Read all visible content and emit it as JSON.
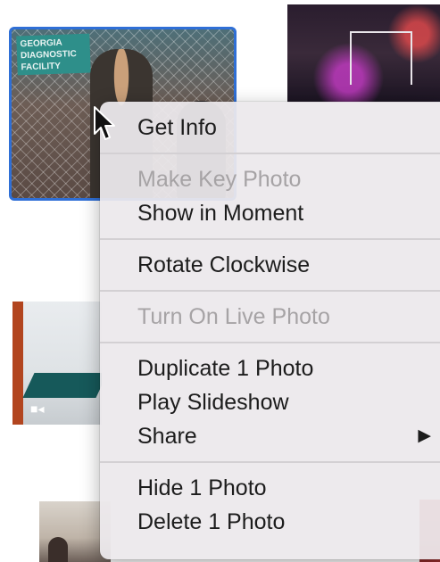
{
  "photos": {
    "selected_sign_text": "GEORGIA\nDIAGNOSTIC\nFACILITY",
    "video_icon": "video-camera-icon"
  },
  "context_menu": {
    "groups": [
      [
        {
          "label": "Get Info",
          "enabled": true
        }
      ],
      [
        {
          "label": "Make Key Photo",
          "enabled": false
        },
        {
          "label": "Show in Moment",
          "enabled": true
        }
      ],
      [
        {
          "label": "Rotate Clockwise",
          "enabled": true
        }
      ],
      [
        {
          "label": "Turn On Live Photo",
          "enabled": false
        }
      ],
      [
        {
          "label": "Duplicate 1 Photo",
          "enabled": true
        },
        {
          "label": "Play Slideshow",
          "enabled": true
        },
        {
          "label": "Share",
          "enabled": true,
          "submenu_indicator": "▶"
        }
      ],
      [
        {
          "label": "Hide 1 Photo",
          "enabled": true
        },
        {
          "label": "Delete 1 Photo",
          "enabled": true
        }
      ]
    ]
  },
  "colors": {
    "selection_border": "#2f6fd6",
    "menu_background": "#ece9ec",
    "disabled_text": "#a6a3a5"
  }
}
